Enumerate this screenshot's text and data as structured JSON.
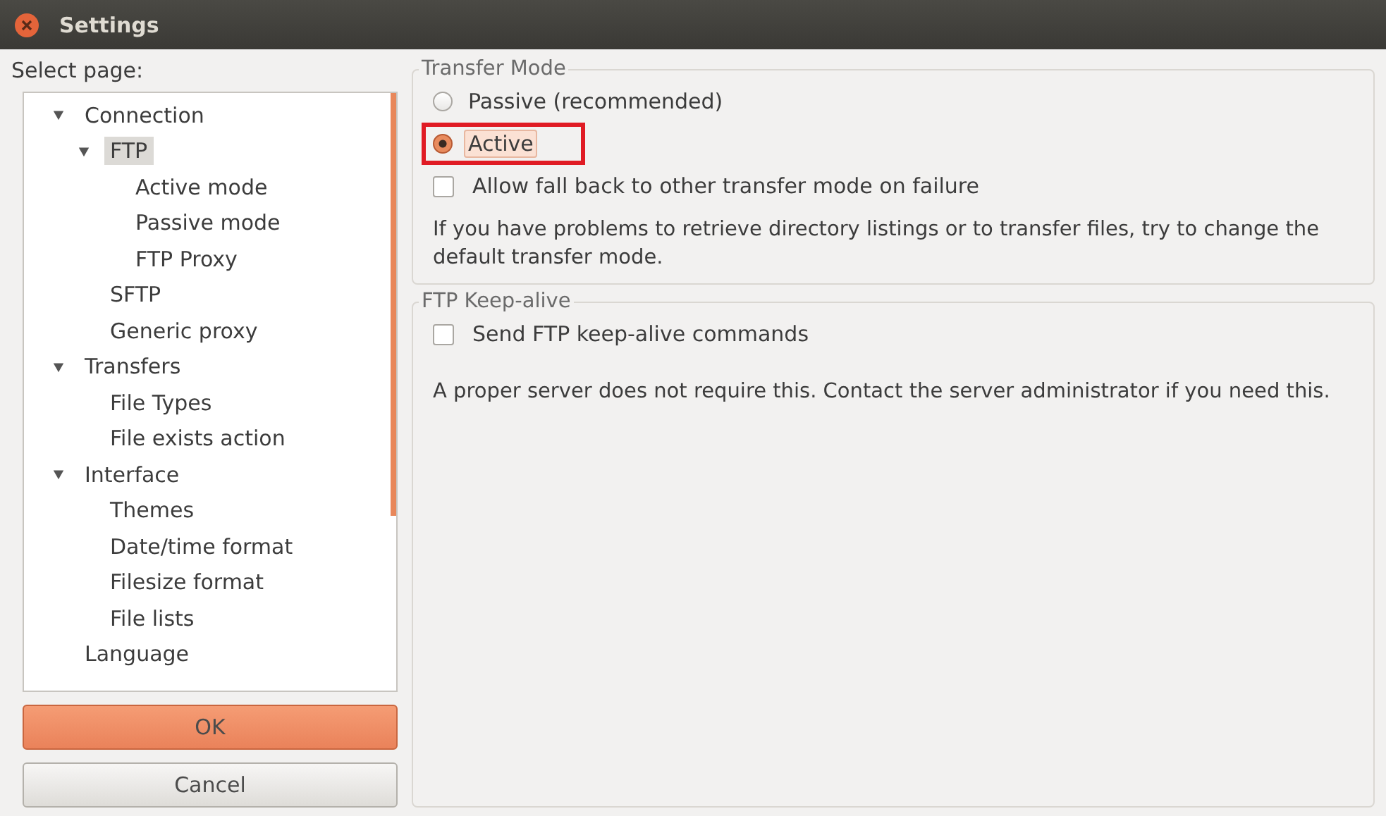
{
  "window": {
    "title": "Settings"
  },
  "sidebar": {
    "label": "Select page:",
    "items": [
      {
        "label": "Connection",
        "expanded": true,
        "selected": false,
        "children": [
          {
            "label": "FTP",
            "expanded": true,
            "selected": true,
            "children": [
              {
                "label": "Active mode",
                "selected": false
              },
              {
                "label": "Passive mode",
                "selected": false
              },
              {
                "label": "FTP Proxy",
                "selected": false
              }
            ]
          },
          {
            "label": "SFTP",
            "selected": false
          },
          {
            "label": "Generic proxy",
            "selected": false
          }
        ]
      },
      {
        "label": "Transfers",
        "expanded": true,
        "selected": false,
        "children": [
          {
            "label": "File Types",
            "selected": false
          },
          {
            "label": "File exists action",
            "selected": false
          }
        ]
      },
      {
        "label": "Interface",
        "expanded": true,
        "selected": false,
        "children": [
          {
            "label": "Themes",
            "selected": false
          },
          {
            "label": "Date/time format",
            "selected": false
          },
          {
            "label": "Filesize format",
            "selected": false
          },
          {
            "label": "File lists",
            "selected": false
          }
        ]
      },
      {
        "label": "Language",
        "selected": false
      }
    ]
  },
  "buttons": [
    {
      "label": "OK",
      "default": true
    },
    {
      "label": "Cancel",
      "default": false
    }
  ],
  "groups": [
    {
      "title": "Transfer Mode",
      "options": [
        {
          "kind": "radio",
          "label": "Passive (recommended)",
          "selected": false,
          "focused": false,
          "highlighted": false
        },
        {
          "kind": "radio",
          "label": "Active",
          "selected": true,
          "focused": true,
          "highlighted": true
        },
        {
          "kind": "checkbox",
          "label": "Allow fall back to other transfer mode on failure",
          "checked": false
        }
      ],
      "note": "If you have problems to retrieve directory listings or to transfer files, try to change the default transfer mode."
    },
    {
      "title": "FTP Keep-alive",
      "options": [
        {
          "kind": "checkbox",
          "label": "Send FTP keep-alive commands",
          "checked": false
        }
      ],
      "note": "A proper server does not require this. Contact the server administrator if you need this."
    }
  ]
}
